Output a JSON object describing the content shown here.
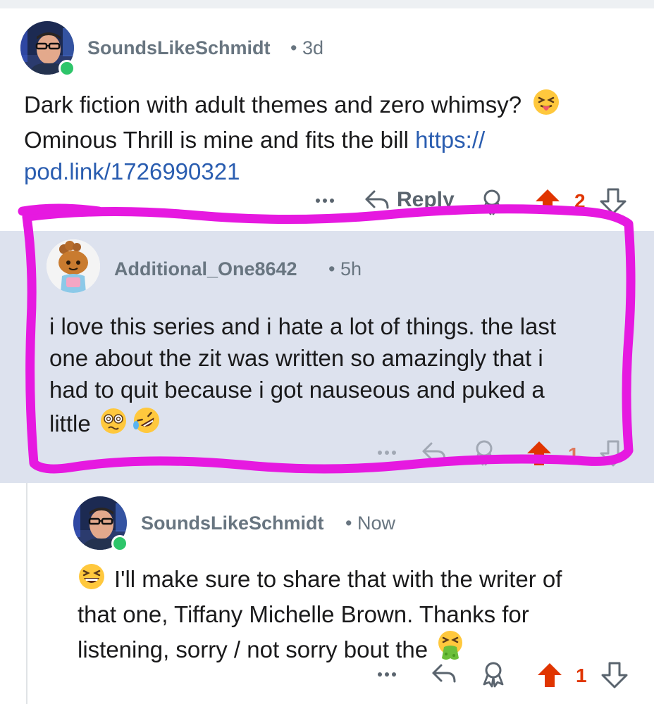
{
  "comments": [
    {
      "username": "SoundsLikeSchmidt",
      "time": "3d",
      "body_text": "Dark fiction with adult themes and zero whimsy? ",
      "body_line2": "Ominous Thrill is mine and fits the bill ",
      "link_part1": "https://",
      "link_part2": "pod.link/1726990321",
      "emoji": "squinting-face-with-tongue",
      "reply_label": "Reply",
      "vote_count": "2",
      "online": true
    },
    {
      "username": "Additional_One8642",
      "time": "5h",
      "body_lines": [
        "i love this series and i hate a lot of things.  the last",
        "one about the zit was written so amazingly that i",
        "had to quit because i got nauseous and puked a",
        "little"
      ],
      "emojis": [
        "dizzy-face",
        "rolling-on-the-floor-laughing"
      ],
      "vote_count": "1",
      "highlighted": true,
      "highlight_color": "#e619e0"
    },
    {
      "username": "SoundsLikeSchmidt",
      "time": "Now",
      "body_lines": [
        "I'll make sure to share that with the writer of",
        "that one, Tiffany Michelle Brown. Thanks for",
        "listening, sorry / not sorry bout the"
      ],
      "emojis": [
        "grinning-squinting-face",
        "face-vomiting"
      ],
      "vote_count": "1",
      "online": true
    }
  ],
  "colors": {
    "upvote": "#e03500",
    "link": "#2a5db0",
    "highlight_bg": "#dde2ee",
    "online": "#2ec56a"
  }
}
